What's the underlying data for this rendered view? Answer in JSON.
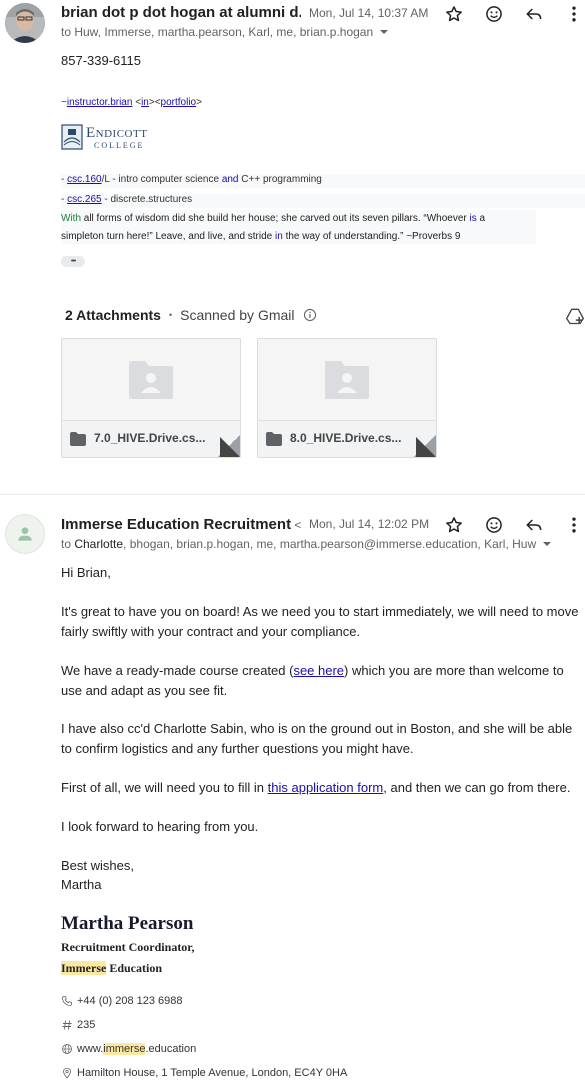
{
  "email1": {
    "sender": "brian dot p dot hogan at alumni d...",
    "date": "Mon, Jul 14, 10:37 AM",
    "to": "to Huw, Immerse, martha.pearson, Karl, me, brian.p.hogan",
    "phone": "857-339-6115",
    "sig": {
      "prefix": "~",
      "name_link": "instructor.brian",
      "lt": " <",
      "in_link": "in",
      "mid": "><",
      "portfolio_link": "portfolio",
      "gt": ">"
    },
    "logo": {
      "word1": "Endicott",
      "word2": "COLLEGE"
    },
    "courses": [
      {
        "dash": "- ",
        "code": "csc.160",
        "rest": "/L - intro computer science ",
        "and": "and",
        "rest2": " C++ programming"
      },
      {
        "dash": "- ",
        "code": "csc.265",
        "rest": " - discrete.structures",
        "and": "",
        "rest2": ""
      }
    ],
    "quote": {
      "w1": "With",
      "t1": " all forms of wisdom did she build her house; she carved out its seven pillars. “Whoever ",
      "is": "is",
      "t2": " a",
      "t3": "simpleton turn here!” Leave, and live, and stride ",
      "in": "in",
      "t4": " the way of understanding.” ~Proverbs 9"
    },
    "ellipsis": "•••",
    "attachments": {
      "title": "2 Attachments",
      "dot": "•",
      "scanned": "Scanned by Gmail",
      "files": [
        "7.0_HIVE.Drive.cs...",
        "8.0_HIVE.Drive.cs..."
      ]
    }
  },
  "email2": {
    "sender": "Immerse Education Recruitment",
    "sender_suffix": " <...",
    "date": "Mon, Jul 14, 12:02 PM",
    "to_prefix": "to ",
    "to_first": "Charlotte",
    "to_rest": ", bhogan, brian.p.hogan, me, martha.pearson@immerse.education, Karl, Huw",
    "greeting": "Hi Brian,",
    "p1": "It's great to have you on board! As we need you to start immediately, we will need to move fairly swiftly with your contract and your compliance.",
    "p2a": "We have a ready-made course created (",
    "p2link": "see here",
    "p2b": ") which you are more than welcome to use and adapt as you see fit.",
    "p3": "I have also cc'd Charlotte Sabin, who is on the ground out in Boston, and she will be able to confirm logistics and any further questions you might have.",
    "p4a": "First of all, we will need you to fill in ",
    "p4link": "this application form",
    "p4b": ", and then we can go from there.",
    "p5": "I look forward to hearing from you.",
    "closing1": "Best wishes,",
    "closing2": "Martha",
    "sig": {
      "name": "Martha Pearson",
      "role": "Recruitment Coordinator,",
      "org_hl": "Immerse",
      "org_rest": " Education",
      "phone": "+44 (0) 208 123 6988",
      "ext": "235",
      "web_pre": "www.",
      "web_hl": "immerse",
      "web_post": ".education",
      "address": "Hamilton House, 1 Temple Avenue, London, EC4Y 0HA"
    }
  },
  "colors": {
    "link": "#1a0dab",
    "highlight": "#fce8a1",
    "muted": "#5f6368",
    "green": "#188038"
  }
}
